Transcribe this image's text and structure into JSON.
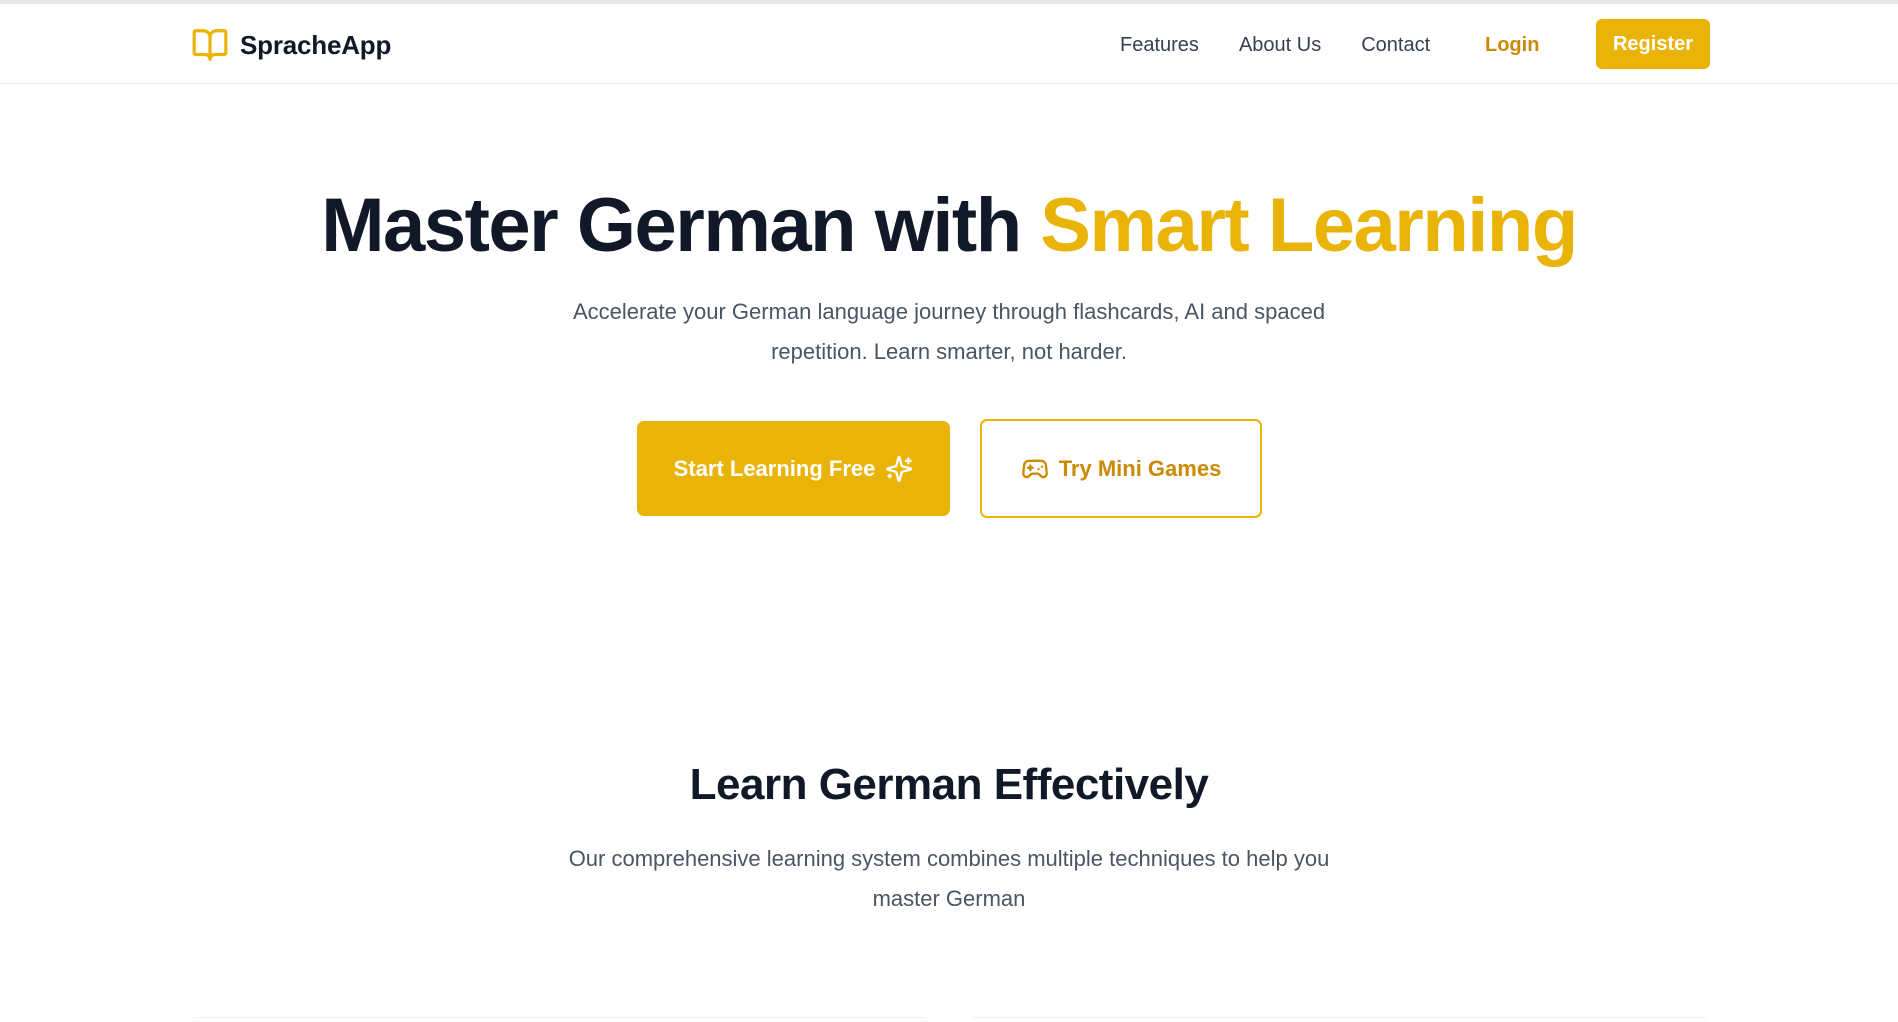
{
  "navbar": {
    "brand_name": "SpracheApp",
    "brand_icon": "open-book-icon",
    "links": [
      "Features",
      "About Us",
      "Contact"
    ],
    "login_label": "Login",
    "register_label": "Register"
  },
  "hero": {
    "title_main": "Master German with ",
    "title_accent": "Smart Learning",
    "subtitle": "Accelerate your German language journey through flashcards, AI and spaced repetition. Learn smarter, not harder.",
    "primary_cta": "Start Learning Free",
    "primary_cta_icon": "sparkles-icon",
    "secondary_cta": "Try Mini Games",
    "secondary_cta_icon": "gamepad-icon"
  },
  "features_section": {
    "title": "Learn German Effectively",
    "subtitle": "Our comprehensive learning system combines multiple techniques to help you master German"
  },
  "colors": {
    "accent": "#eab308",
    "accent_text": "#ca8a04",
    "heading": "#111827",
    "body_text": "#4b5563"
  }
}
